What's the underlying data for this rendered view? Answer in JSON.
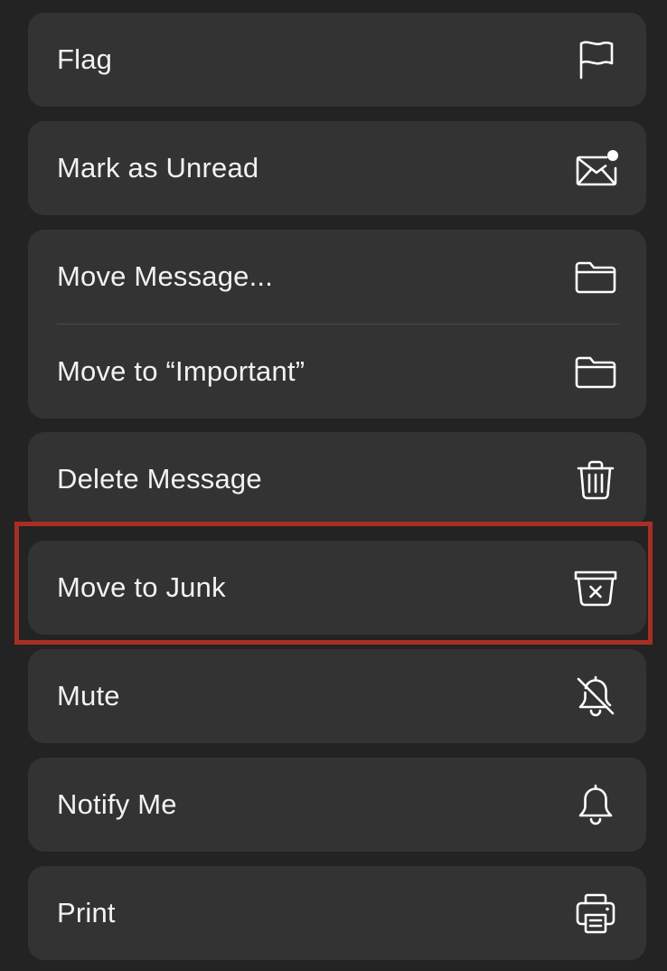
{
  "menu": {
    "items": [
      {
        "label": "Flag",
        "icon": "flag-icon"
      },
      {
        "label": "Mark as Unread",
        "icon": "envelope-unread-icon"
      },
      {
        "label": "Move Message...",
        "icon": "folder-icon"
      },
      {
        "label": "Move to “Important”",
        "icon": "folder-icon"
      },
      {
        "label": "Delete Message",
        "icon": "trash-icon"
      },
      {
        "label": "Move to Junk",
        "icon": "junk-bin-icon"
      },
      {
        "label": "Mute",
        "icon": "bell-slash-icon"
      },
      {
        "label": "Notify Me",
        "icon": "bell-icon"
      },
      {
        "label": "Print",
        "icon": "printer-icon"
      }
    ],
    "highlighted_item": "Move to Junk"
  },
  "colors": {
    "background": "#232323",
    "card": "#333333",
    "text": "#f2f2f2",
    "highlight_border": "#a92e22"
  }
}
